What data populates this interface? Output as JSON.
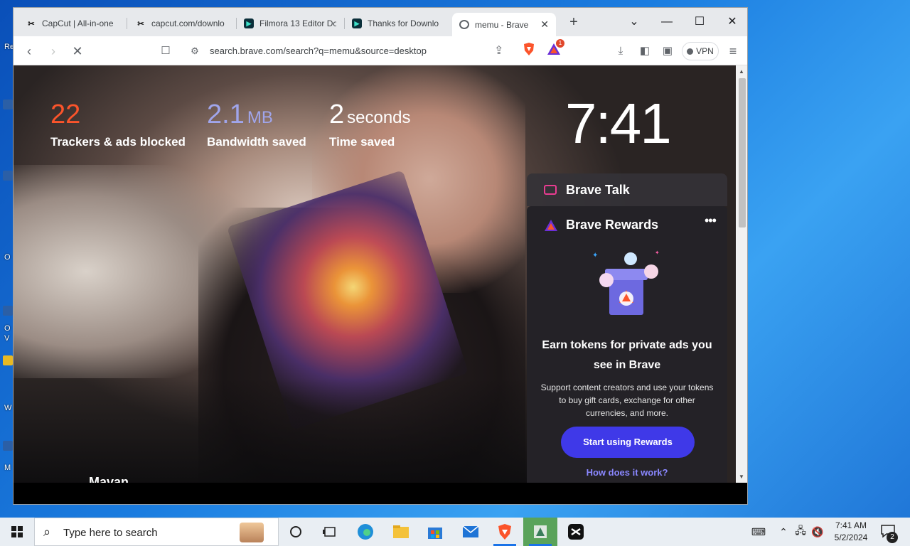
{
  "browser": {
    "tabs": [
      {
        "title": "CapCut | All-in-one",
        "favicon": "capcut-icon"
      },
      {
        "title": "capcut.com/downlo",
        "favicon": "capcut-icon"
      },
      {
        "title": "Filmora 13 Editor Do",
        "favicon": "filmora-icon"
      },
      {
        "title": "Thanks for Downlo",
        "favicon": "filmora-icon"
      },
      {
        "title": "memu - Brave ",
        "favicon": "globe-icon",
        "active": true
      }
    ],
    "url": "search.brave.com/search?q=memu&source=desktop",
    "rewards_badge": "1",
    "vpn_label": "VPN"
  },
  "newtab_page": {
    "stats": [
      {
        "value": "22",
        "unit": "",
        "label": "Trackers & ads blocked",
        "color": "#fb542b"
      },
      {
        "value": "2.1",
        "unit": "MB",
        "label": "Bandwidth saved",
        "color": "#a0a5eb"
      },
      {
        "value": "2",
        "unit": "seconds",
        "label": "Time saved",
        "color": "#ffffff"
      }
    ],
    "clock": "7:41",
    "partial_bottom_text": "Mavan",
    "brave_talk": {
      "title": "Brave Talk"
    },
    "brave_rewards": {
      "title": "Brave Rewards",
      "headline": "Earn tokens for private ads you see in Brave",
      "description": "Support content creators and use your tokens to buy gift cards, exchange for other currencies, and more.",
      "cta": "Start using Rewards",
      "link": "How does it work?"
    }
  },
  "taskbar": {
    "search_placeholder": "Type here to search",
    "time": "7:41 AM",
    "date": "5/2/2024",
    "notification_count": "2"
  },
  "desktop": {
    "icon_labels": [
      "Re",
      "O",
      "O",
      "V",
      "W",
      "M"
    ]
  },
  "colors": {
    "accent_purple": "#3f39e8",
    "brave_orange": "#fb542b",
    "rewards_link": "#8a87ff"
  }
}
